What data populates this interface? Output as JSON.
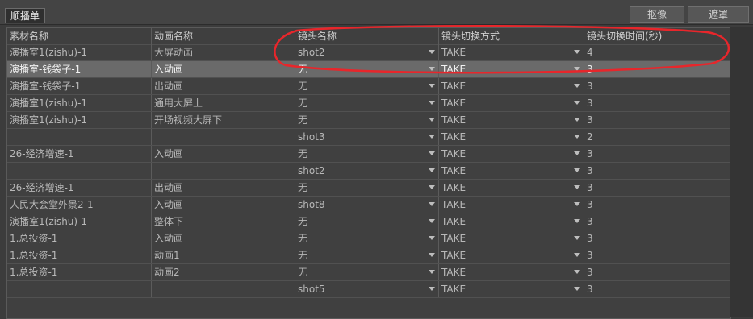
{
  "tab_label": "顺播单",
  "buttons": {
    "capture": "抠像",
    "mask": "遮罩"
  },
  "columns": [
    "素材名称",
    "动画名称",
    "镜头名称",
    "镜头切换方式",
    "镜头切换时间(秒)"
  ],
  "rows": [
    {
      "material": "演播室1(zishu)-1",
      "animation": "大屏动画",
      "shot": "shot2",
      "mode": "TAKE",
      "time": "4"
    },
    {
      "material": "演播室-钱袋子-1",
      "animation": "入动画",
      "shot": "无",
      "mode": "TAKE",
      "time": "3"
    },
    {
      "material": "演播室-钱袋子-1",
      "animation": "出动画",
      "shot": "无",
      "mode": "TAKE",
      "time": "3"
    },
    {
      "material": "演播室1(zishu)-1",
      "animation": "通用大屏上",
      "shot": "无",
      "mode": "TAKE",
      "time": "3"
    },
    {
      "material": "演播室1(zishu)-1",
      "animation": "开场视频大屏下",
      "shot": "无",
      "mode": "TAKE",
      "time": "3"
    },
    {
      "material": "",
      "animation": "",
      "shot": "shot3",
      "mode": "TAKE",
      "time": "2"
    },
    {
      "material": "26-经济增速-1",
      "animation": "入动画",
      "shot": "无",
      "mode": "TAKE",
      "time": "3"
    },
    {
      "material": "",
      "animation": "",
      "shot": "shot2",
      "mode": "TAKE",
      "time": "3"
    },
    {
      "material": "26-经济增速-1",
      "animation": "出动画",
      "shot": "无",
      "mode": "TAKE",
      "time": "3"
    },
    {
      "material": "人民大会堂外景2-1",
      "animation": "入动画",
      "shot": "shot8",
      "mode": "TAKE",
      "time": "3"
    },
    {
      "material": "演播室1(zishu)-1",
      "animation": "整体下",
      "shot": "无",
      "mode": "TAKE",
      "time": "3"
    },
    {
      "material": "1.总投资-1",
      "animation": "入动画",
      "shot": "无",
      "mode": "TAKE",
      "time": "3"
    },
    {
      "material": "1.总投资-1",
      "animation": "动画1",
      "shot": "无",
      "mode": "TAKE",
      "time": "3"
    },
    {
      "material": "1.总投资-1",
      "animation": "动画2",
      "shot": "无",
      "mode": "TAKE",
      "time": "3"
    },
    {
      "material": "",
      "animation": "",
      "shot": "shot5",
      "mode": "TAKE",
      "time": "3"
    }
  ],
  "selected_row_index": 1,
  "colors": {
    "annotation_red": "#e8262b",
    "selected_bg": "#6a6a6a"
  }
}
